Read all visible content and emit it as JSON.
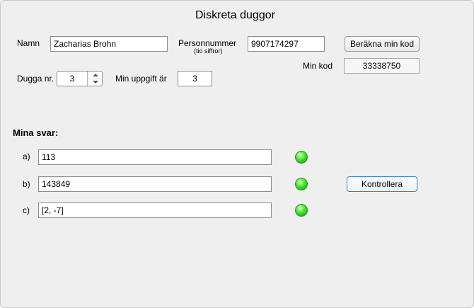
{
  "window": {
    "title": "Diskreta duggor"
  },
  "form": {
    "name_label": "Namn",
    "name_value": "Zacharias Brohn",
    "pnr_label": "Personnummer",
    "pnr_sublabel": "(tio siffror)",
    "pnr_value": "9907174297",
    "compute_button": "Beräkna min kod",
    "code_label": "Min kod",
    "code_value": "33338750",
    "dugga_label": "Dugga nr.",
    "dugga_value": "3",
    "task_label": "Min uppgift är",
    "task_value": "3"
  },
  "answers": {
    "heading": "Mina svar:",
    "items": [
      {
        "label": "a)",
        "value": "113",
        "status": "correct"
      },
      {
        "label": "b)",
        "value": "143849",
        "status": "correct"
      },
      {
        "label": "c)",
        "value": "[2, -7]",
        "status": "correct"
      }
    ],
    "check_button": "Kontrollera"
  },
  "colors": {
    "indicator_ok": "#2bd11e",
    "focus_border": "#3a7fc9"
  }
}
